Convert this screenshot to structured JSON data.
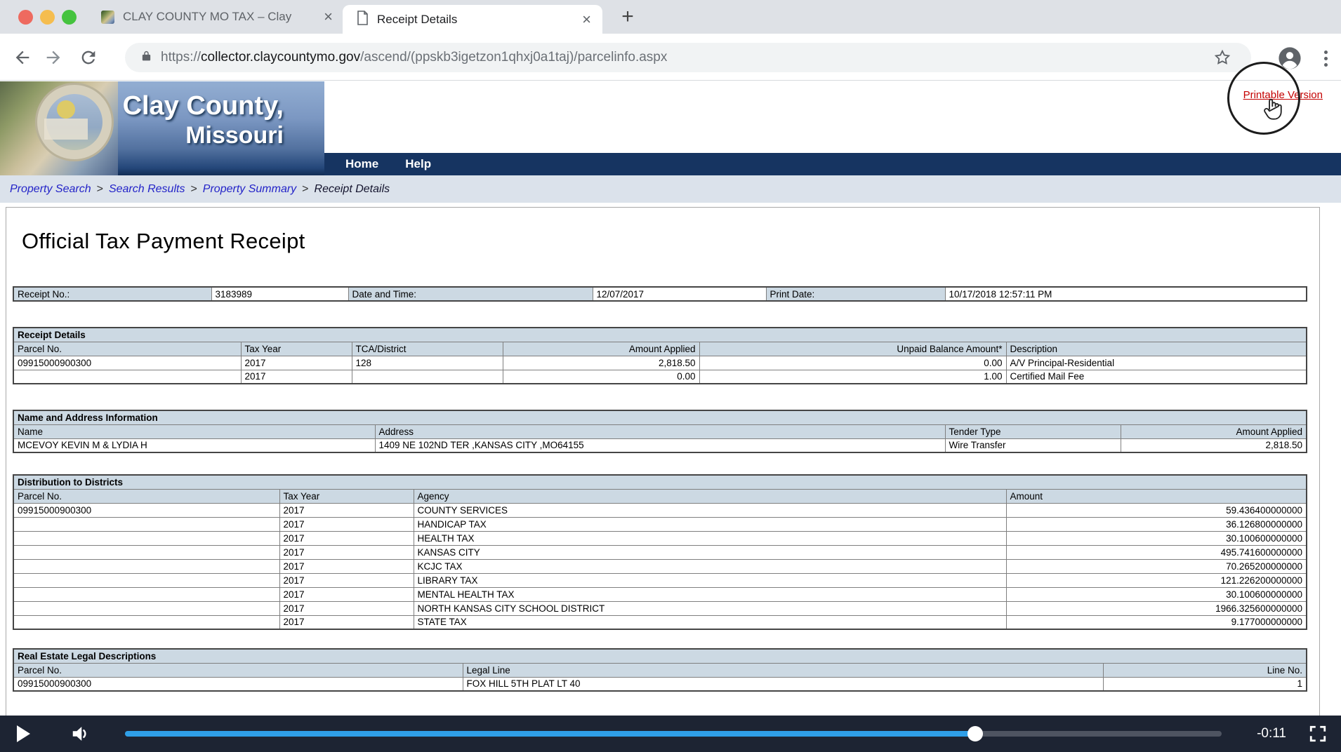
{
  "glyphs": {
    "close": "×",
    "new_tab": "+"
  },
  "browser": {
    "tab1_title": "CLAY COUNTY MO TAX – Clay",
    "tab2_title": "Receipt Details",
    "url": {
      "scheme": "https://",
      "domain": "collector.claycountymo.gov",
      "path": "/ascend/(ppskb3igetzon1qhxj0a1taj)/parcelinfo.aspx"
    }
  },
  "site": {
    "banner": {
      "line1": "Clay County,",
      "line2": "Missouri"
    },
    "printable_link": "Printable Version",
    "nav": {
      "home": "Home",
      "help": "Help"
    },
    "breadcrumb": {
      "sep": ">",
      "items": [
        "Property Search",
        "Search Results",
        "Property Summary",
        "Receipt Details"
      ]
    }
  },
  "page": {
    "title": "Official Tax Payment Receipt",
    "meta_table": {
      "cells": [
        {
          "label": "Receipt No.:",
          "value": "3183989"
        },
        {
          "label": "Date and Time:",
          "value": "12/07/2017"
        },
        {
          "label": "Print Date:",
          "value": "10/17/2018 12:57:11 PM"
        }
      ]
    },
    "receipt_details": {
      "title": "Receipt Details",
      "columns": [
        "Parcel No.",
        "Tax Year",
        "TCA/District",
        "Amount Applied",
        "Unpaid Balance Amount*",
        "Description"
      ],
      "head_aligns": [
        "l",
        "l",
        "l",
        "r",
        "r",
        "l"
      ],
      "col_aligns": [
        "l",
        "l",
        "l",
        "r",
        "r",
        "l"
      ],
      "rows": [
        [
          "09915000900300",
          "2017",
          "128",
          "2,818.50",
          "0.00",
          "A/V Principal-Residential"
        ],
        [
          "",
          "2017",
          "",
          "0.00",
          "1.00",
          "Certified Mail Fee"
        ]
      ]
    },
    "name_address": {
      "title": "Name and Address Information",
      "columns": [
        "Name",
        "Address",
        "Tender Type",
        "Amount Applied"
      ],
      "head_aligns": [
        "l",
        "l",
        "l",
        "r"
      ],
      "col_aligns": [
        "l",
        "l",
        "l",
        "r"
      ],
      "rows": [
        [
          "MCEVOY KEVIN M & LYDIA H",
          "1409 NE 102ND TER ,KANSAS CITY ,MO64155",
          "Wire Transfer",
          "2,818.50"
        ]
      ]
    },
    "distribution": {
      "title": "Distribution to Districts",
      "columns": [
        "Parcel No.",
        "Tax Year",
        "Agency",
        "Amount"
      ],
      "head_aligns": [
        "l",
        "l",
        "l",
        "l"
      ],
      "col_aligns": [
        "l",
        "l",
        "l",
        "r"
      ],
      "rows": [
        [
          "09915000900300",
          "2017",
          "COUNTY SERVICES",
          "59.436400000000"
        ],
        [
          "",
          "2017",
          "HANDICAP TAX",
          "36.126800000000"
        ],
        [
          "",
          "2017",
          "HEALTH TAX",
          "30.100600000000"
        ],
        [
          "",
          "2017",
          "KANSAS CITY",
          "495.741600000000"
        ],
        [
          "",
          "2017",
          "KCJC TAX",
          "70.265200000000"
        ],
        [
          "",
          "2017",
          "LIBRARY TAX",
          "121.226200000000"
        ],
        [
          "",
          "2017",
          "MENTAL HEALTH TAX",
          "30.100600000000"
        ],
        [
          "",
          "2017",
          "NORTH KANSAS CITY SCHOOL DISTRICT",
          "1966.325600000000"
        ],
        [
          "",
          "2017",
          "STATE TAX",
          "9.177000000000"
        ]
      ]
    },
    "legal": {
      "title": "Real Estate Legal Descriptions",
      "columns": [
        "Parcel No.",
        "Legal Line",
        "Line No."
      ],
      "head_aligns": [
        "l",
        "l",
        "r"
      ],
      "col_aligns": [
        "l",
        "l",
        "r"
      ],
      "rows": [
        [
          "09915000900300",
          "FOX HILL 5TH PLAT LT 40",
          "1"
        ]
      ]
    }
  },
  "player": {
    "time": "-0:11",
    "progress_pct": 77.5
  },
  "colors": {
    "accent_blue": "#2f9fe8",
    "navbar_navy": "#163461",
    "link_red": "#c40000",
    "breadcrumb_link_blue": "#2323c8",
    "table_header_bg": "#ccd9e3"
  }
}
